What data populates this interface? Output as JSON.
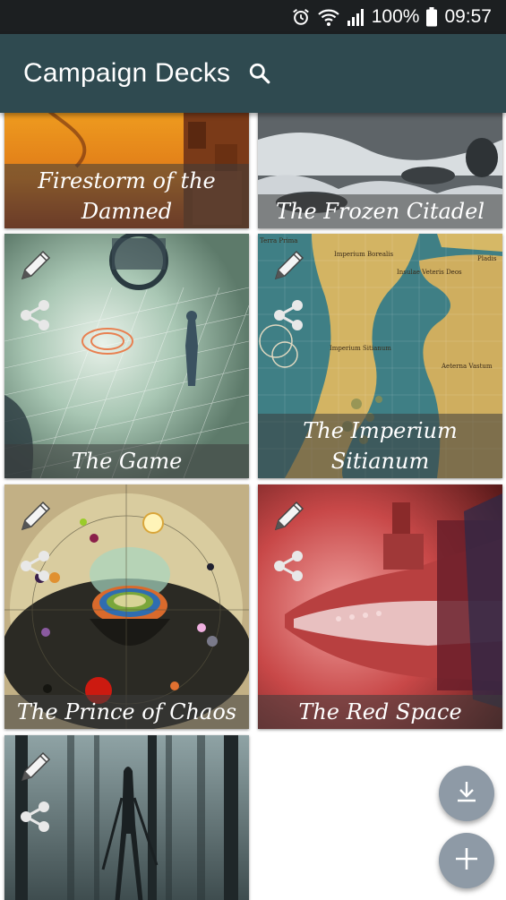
{
  "status_bar": {
    "battery": "100%",
    "time": "09:57",
    "icons": [
      "alarm-icon",
      "wifi-icon",
      "signal-icon",
      "battery-icon"
    ]
  },
  "app_bar": {
    "title": "Campaign Decks",
    "search_icon": "search-icon",
    "background": "#2f4a50"
  },
  "decks": [
    {
      "title": "Firestorm of the Damned"
    },
    {
      "title": "The Frozen Citadel"
    },
    {
      "title": "The Game",
      "actions": [
        "edit-icon",
        "share-icon"
      ]
    },
    {
      "title": "The Imperium Sitianum",
      "actions": [
        "edit-icon",
        "share-icon"
      ],
      "map_labels": [
        "Terra Prima",
        "Imperium Borealis",
        "Insulae Veteris Deos",
        "Imperium Sitianum",
        "Aeterna Vastum",
        "Pladis"
      ]
    },
    {
      "title": "The Prince of Chaos",
      "actions": [
        "edit-icon",
        "share-icon"
      ]
    },
    {
      "title": "The Red Space",
      "actions": [
        "edit-icon",
        "share-icon"
      ]
    },
    {
      "title": "",
      "actions": [
        "edit-icon",
        "share-icon"
      ]
    }
  ],
  "fabs": {
    "download_icon": "download-icon",
    "add_icon": "add-icon",
    "color": "#8e9aa6"
  }
}
